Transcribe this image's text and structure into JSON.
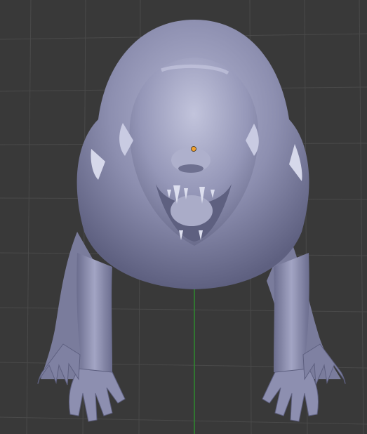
{
  "viewport": {
    "mode": "3d-viewport",
    "background_color": "#393939",
    "grid_line_color": "#4a4a4a",
    "z_axis_color": "#2f8a2f",
    "origin_color": "#f0a030",
    "model_color": "#8d8fb0",
    "model_shadow_color": "#5b5d7c",
    "model_highlight_color": "#c6c8e0"
  },
  "scene": {
    "object": "sculpted-creature-model",
    "view": "front",
    "shading": "solid"
  }
}
